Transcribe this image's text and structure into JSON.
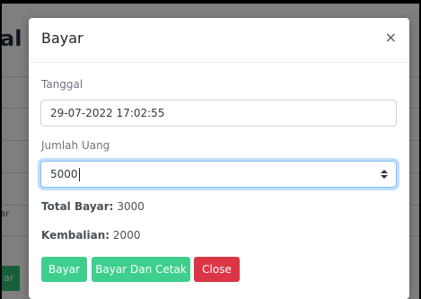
{
  "background": {
    "title_fragment": "al",
    "button_fragment": "ar",
    "row_stub": "ar"
  },
  "modal": {
    "title": "Bayar",
    "close_glyph": "×",
    "fields": {
      "tanggal": {
        "label": "Tanggal",
        "value": "29-07-2022 17:02:55"
      },
      "jumlah_uang": {
        "label": "Jumlah Uang",
        "value": "5000"
      }
    },
    "summary": {
      "total_label": "Total Bayar:",
      "total_value": "3000",
      "kembalian_label": "Kembalian:",
      "kembalian_value": "2000"
    },
    "buttons": {
      "bayar": "Bayar",
      "bayar_cetak": "Bayar Dan Cetak",
      "close": "Close"
    }
  },
  "colors": {
    "green": "#3ecf8e",
    "red": "#dc3545",
    "focus_border": "#80bdff"
  },
  "icons": {
    "close": "close-icon",
    "spinner": "spinner-updown-icon"
  }
}
